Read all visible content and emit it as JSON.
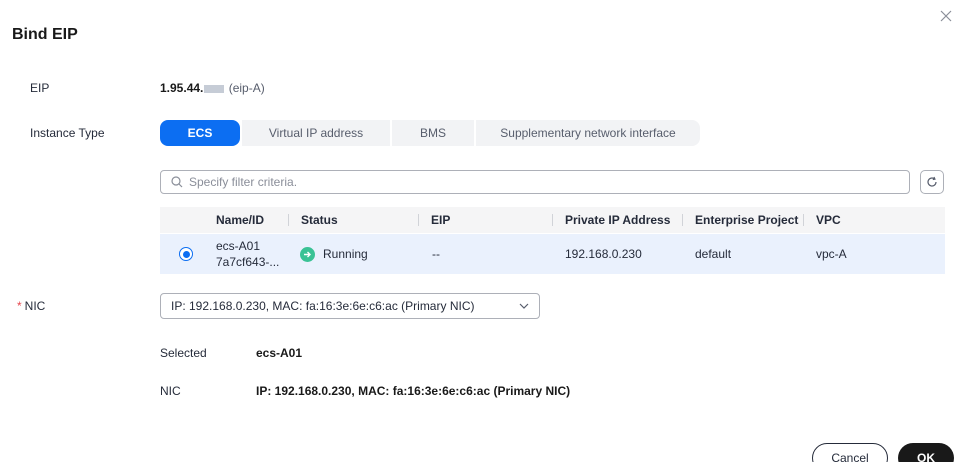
{
  "dialog": {
    "title": "Bind EIP"
  },
  "eip": {
    "label": "EIP",
    "address": "1.95.44.",
    "name": "(eip-A)"
  },
  "instance_type": {
    "label": "Instance Type",
    "options": [
      "ECS",
      "Virtual IP address",
      "BMS",
      "Supplementary network interface"
    ],
    "selected": "ECS"
  },
  "filter": {
    "placeholder": "Specify filter criteria."
  },
  "table": {
    "columns": [
      "Name/ID",
      "Status",
      "EIP",
      "Private IP Address",
      "Enterprise Project",
      "VPC"
    ],
    "rows": [
      {
        "name": "ecs-A01",
        "id": "7a7cf643-...",
        "status": "Running",
        "eip": "--",
        "private_ip": "192.168.0.230",
        "enterprise_project": "default",
        "vpc": "vpc-A",
        "selected": true
      }
    ]
  },
  "nic": {
    "label": "NIC",
    "value": "IP: 192.168.0.230, MAC: fa:16:3e:6e:c6:ac (Primary NIC)"
  },
  "summary": {
    "selected_label": "Selected",
    "selected_value": "ecs-A01",
    "nic_label": "NIC",
    "nic_value": "IP: 192.168.0.230, MAC: fa:16:3e:6e:c6:ac (Primary NIC)"
  },
  "footer": {
    "cancel_label": "Cancel",
    "ok_label": "OK"
  },
  "colors": {
    "primary": "#0c6ef2",
    "running": "#3ac295",
    "required": "#e6474e",
    "selected_row": "#eaf1fd"
  }
}
